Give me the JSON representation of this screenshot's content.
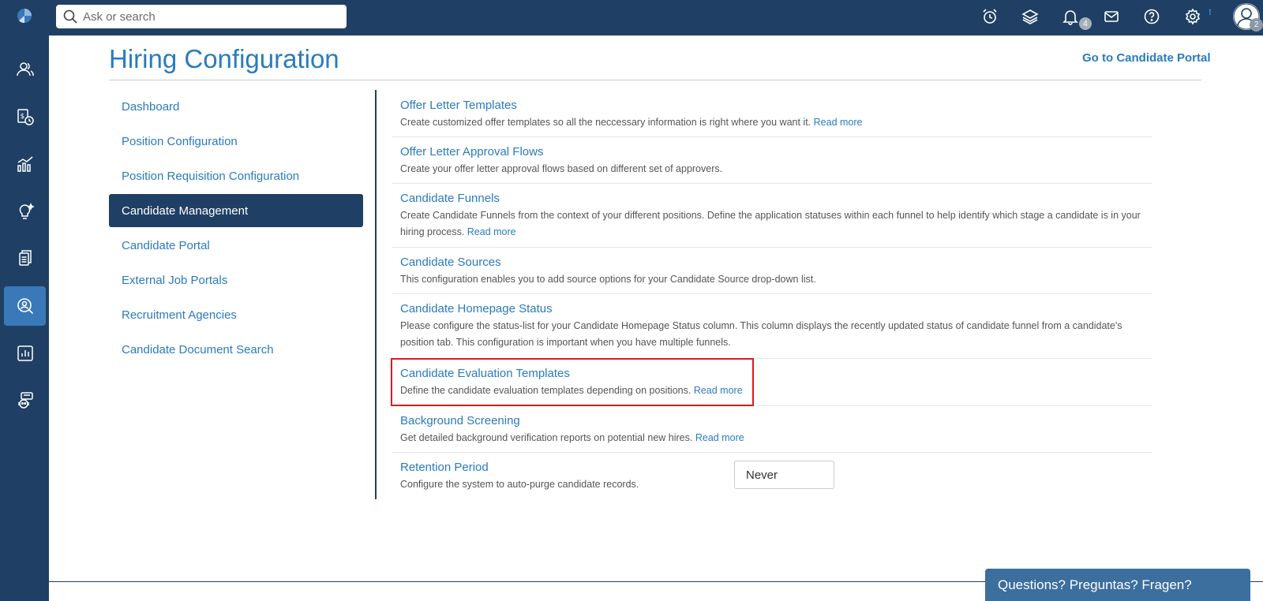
{
  "search": {
    "placeholder": "Ask or search"
  },
  "topbar": {
    "icons": [
      "alarm-clock-icon",
      "layers-icon",
      "bell-icon",
      "mail-icon",
      "help-icon",
      "gear-icon",
      "user-avatar-icon"
    ],
    "notification_count": "4",
    "settings_indicator": "!",
    "avatar_badge": "2"
  },
  "rail": {
    "items": [
      "people-icon",
      "payroll-clock-icon",
      "analytics-chart-icon",
      "lightbulb-icon",
      "documents-icon",
      "recruitment-search-icon",
      "reports-icon",
      "support-bot-icon"
    ],
    "active_index": 5
  },
  "header": {
    "title": "Hiring Configuration",
    "portal_link": "Go to Candidate Portal"
  },
  "nav": {
    "items": [
      "Dashboard",
      "Position Configuration",
      "Position Requisition Configuration",
      "Candidate Management",
      "Candidate Portal",
      "External Job Portals",
      "Recruitment Agencies",
      "Candidate Document Search"
    ],
    "active": "Candidate Management"
  },
  "configs": [
    {
      "title": "Offer Letter Templates",
      "desc": "Create customized offer templates so all the neccessary information is right where you want it.",
      "read_more": "Read more"
    },
    {
      "title": "Offer Letter Approval Flows",
      "desc": "Create your offer letter approval flows based on different set of approvers."
    },
    {
      "title": "Candidate Funnels",
      "desc": "Create Candidate Funnels from the context of your different positions. Define the application statuses within each funnel to help identify which stage a candidate is in your hiring process.",
      "read_more": "Read more"
    },
    {
      "title": "Candidate Sources",
      "desc": "This configuration enables you to add source options for your Candidate Source drop-down list."
    },
    {
      "title": "Candidate Homepage Status",
      "desc": "Please configure the status-list for your Candidate Homepage Status column. This column displays the recently updated status of candidate funnel from a candidate's position tab. This configuration is important when you have multiple funnels."
    },
    {
      "title": "Candidate Evaluation Templates",
      "desc": "Define the candidate evaluation templates depending on positions.",
      "read_more": "Read more"
    },
    {
      "title": "Background Screening",
      "desc": "Get detailed background verification reports on potential new hires.",
      "read_more": "Read more"
    },
    {
      "title": "Retention Period",
      "desc": "Configure the system to auto-purge candidate records.",
      "select_value": "Never"
    }
  ],
  "help_tab": "Questions? Preguntas? Fragen?",
  "colors": {
    "brand": "#1f4064",
    "link": "#2a7bbf",
    "active_rail": "#3a79b8",
    "highlight": "#e0191d"
  }
}
